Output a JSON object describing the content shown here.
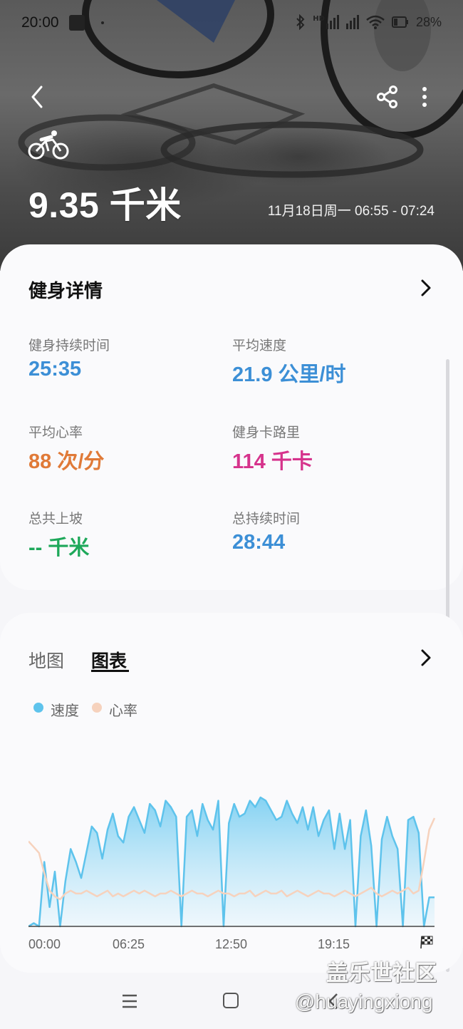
{
  "status_bar": {
    "time": "20:00",
    "hd_label": "HD",
    "battery_text": "28%"
  },
  "hero": {
    "distance": "9.35 千米",
    "datetime": "11月18日周一 06:55 - 07:24"
  },
  "details": {
    "title": "健身详情",
    "stats": [
      {
        "label": "健身持续时间",
        "value": "25:35",
        "color": "#3c8fd6"
      },
      {
        "label": "平均速度",
        "value": "21.9 公里/时",
        "color": "#3c8fd6"
      },
      {
        "label": "平均心率",
        "value": "88 次/分",
        "color": "#e07a38"
      },
      {
        "label": "健身卡路里",
        "value": "114 千卡",
        "color": "#d6338c"
      },
      {
        "label": "总共上坡",
        "value": "-- 千米",
        "color": "#1ea85a"
      },
      {
        "label": "总持续时间",
        "value": "28:44",
        "color": "#3c8fd6"
      }
    ]
  },
  "chart_section": {
    "tabs": [
      {
        "label": "地图",
        "active": false
      },
      {
        "label": "图表",
        "active": true
      }
    ],
    "legend": [
      {
        "label": "速度",
        "color": "#5ec3ec"
      },
      {
        "label": "心率",
        "color": "#f6d2bd"
      }
    ]
  },
  "chart_data": {
    "type": "area",
    "xlabel": "",
    "ylabel": "",
    "x_ticks": [
      "00:00",
      "06:25",
      "12:50",
      "19:15"
    ],
    "x_range_minutes": [
      0,
      25.6
    ],
    "series": [
      {
        "name": "速度",
        "color": "#5ec3ec",
        "values": [
          0,
          1,
          0,
          20,
          6,
          17,
          0,
          14,
          24,
          20,
          15,
          23,
          31,
          29,
          21,
          30,
          35,
          28,
          26,
          34,
          37,
          33,
          29,
          38,
          36,
          31,
          39,
          37,
          34,
          0,
          34,
          36,
          28,
          38,
          33,
          30,
          39,
          0,
          32,
          38,
          34,
          35,
          39,
          37,
          40,
          39,
          36,
          33,
          34,
          39,
          35,
          32,
          37,
          30,
          37,
          28,
          33,
          36,
          24,
          35,
          24,
          33,
          0,
          28,
          36,
          25,
          0,
          27,
          34,
          28,
          24,
          0,
          33,
          34,
          29,
          0,
          9,
          9
        ]
      },
      {
        "name": "心率",
        "color": "#f6d2bd",
        "values": [
          26,
          24,
          22,
          15,
          9,
          7,
          6,
          8,
          9,
          8,
          8,
          9,
          8,
          7,
          8,
          9,
          7,
          8,
          7,
          8,
          9,
          8,
          9,
          8,
          7,
          8,
          8,
          9,
          8,
          7,
          8,
          9,
          8,
          8,
          7,
          8,
          9,
          8,
          8,
          7,
          8,
          8,
          9,
          7,
          8,
          9,
          8,
          8,
          9,
          7,
          8,
          9,
          8,
          7,
          8,
          9,
          8,
          8,
          7,
          8,
          9,
          8,
          7,
          8,
          9,
          10,
          8,
          7,
          8,
          9,
          8,
          9,
          10,
          8,
          9,
          19,
          30,
          34
        ]
      }
    ]
  },
  "watermark": {
    "line1": "盖乐世社区",
    "line2": "@huayingxiong"
  }
}
